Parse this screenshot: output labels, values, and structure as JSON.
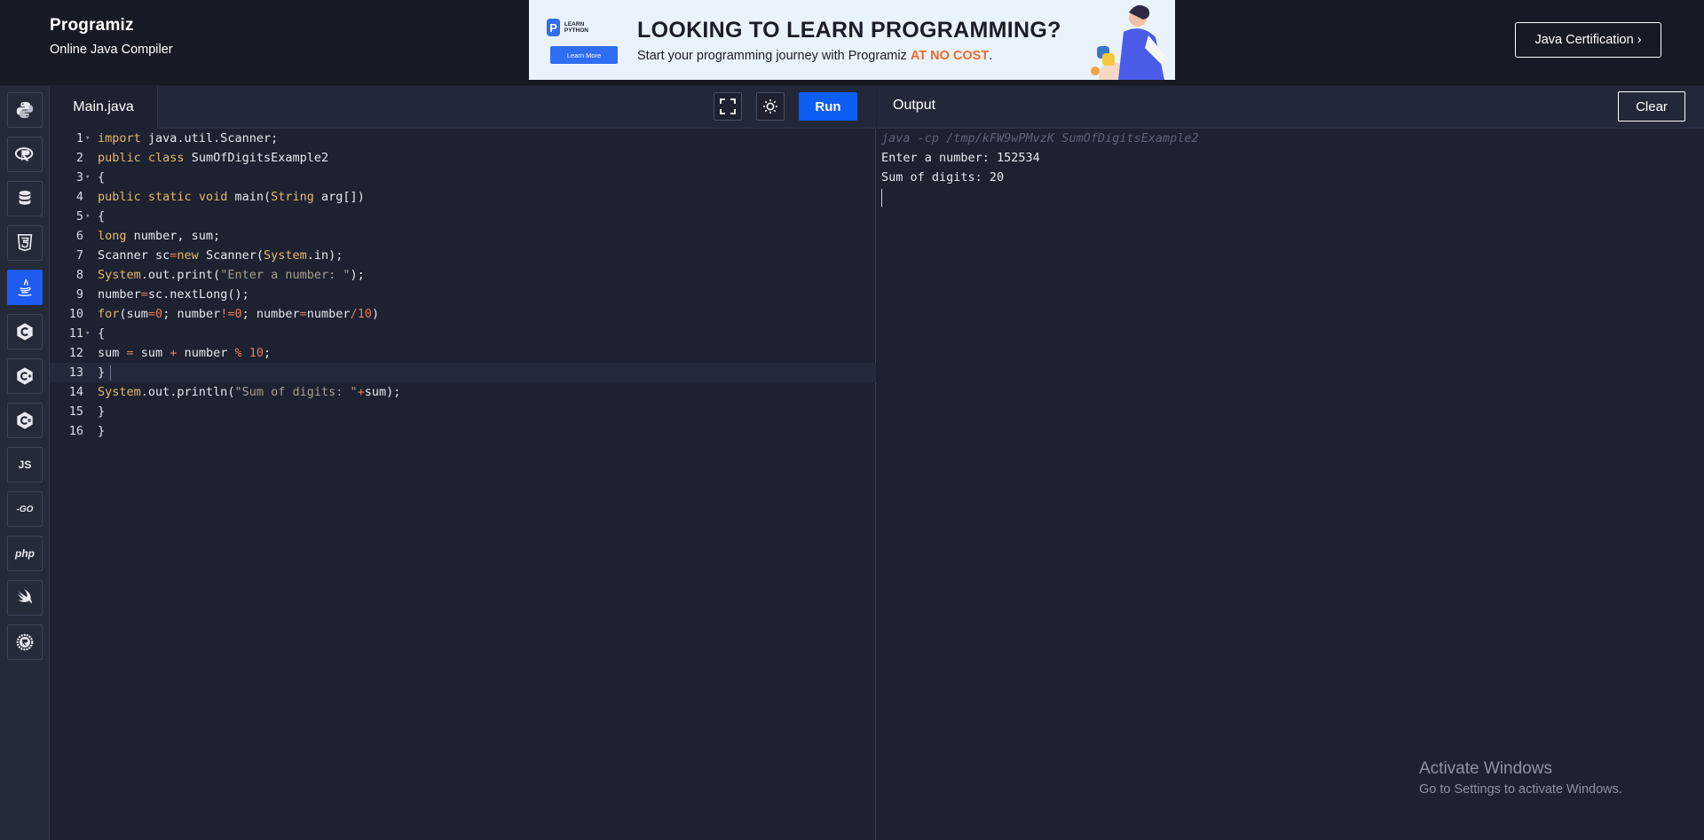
{
  "header": {
    "logo": "Programiz",
    "tagline": "Online Java Compiler",
    "cert_button": "Java Certification ›"
  },
  "ad": {
    "badge_text": "LEARN PYTHON",
    "learn_button": "Learn More",
    "headline": "LOOKING TO LEARN PROGRAMMING?",
    "sub_text": "Start your programming journey with Programiz",
    "sub_highlight": "AT NO COST",
    "sub_end": "."
  },
  "sidebar": {
    "items": [
      {
        "name": "python",
        "label": ""
      },
      {
        "name": "r",
        "label": ""
      },
      {
        "name": "sql",
        "label": ""
      },
      {
        "name": "html",
        "label": ""
      },
      {
        "name": "java",
        "label": "",
        "active": true
      },
      {
        "name": "c",
        "label": ""
      },
      {
        "name": "cpp",
        "label": ""
      },
      {
        "name": "csharp",
        "label": ""
      },
      {
        "name": "javascript",
        "label": "JS"
      },
      {
        "name": "go",
        "label": "-GO"
      },
      {
        "name": "php",
        "label": "php"
      },
      {
        "name": "swift",
        "label": ""
      },
      {
        "name": "rust",
        "label": ""
      }
    ]
  },
  "editor": {
    "tab_label": "Main.java",
    "run_label": "Run",
    "lines": [
      "import java.util.Scanner;",
      "public class SumOfDigitsExample2",
      "{",
      "public static void main(String arg[])",
      "{",
      "long number, sum;",
      "Scanner sc=new Scanner(System.in);",
      "System.out.print(\"Enter a number: \");",
      "number=sc.nextLong();",
      "for(sum=0; number!=0; number=number/10)",
      "{",
      "sum = sum + number % 10;",
      "}",
      "System.out.println(\"Sum of digits: \"+sum);",
      "}",
      "}"
    ]
  },
  "output": {
    "title": "Output",
    "clear_label": "Clear",
    "command": "java -cp /tmp/kFW9wPMvzK SumOfDigitsExample2",
    "lines": [
      "Enter a number: 152534",
      "Sum of digits: 20"
    ]
  },
  "watermark": {
    "title": "Activate Windows",
    "subtitle": "Go to Settings to activate Windows."
  },
  "colors": {
    "accent": "#0d5ef3",
    "keyword": "#e4b96b",
    "string": "#a7a08c",
    "number": "#e57b55"
  }
}
